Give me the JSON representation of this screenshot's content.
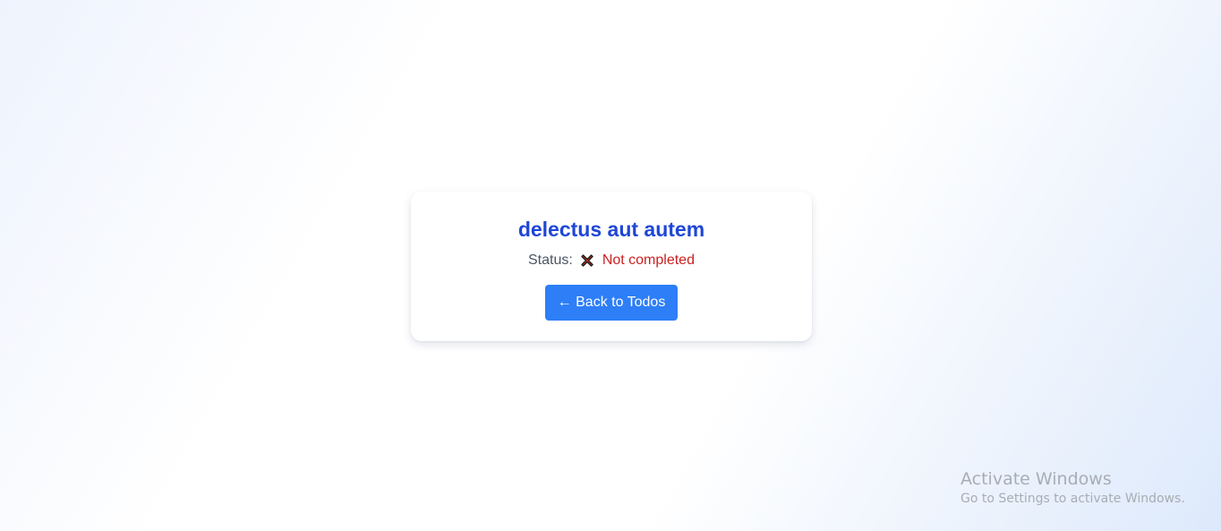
{
  "todo": {
    "title": "delectus aut autem",
    "status_label": "Status:",
    "status_icon": "cross-mark-icon",
    "status_value": "Not completed",
    "status_color": "#cc1f1f"
  },
  "actions": {
    "back_label": "← Back to Todos"
  },
  "watermark": {
    "title": "Activate Windows",
    "subtitle": "Go to Settings to activate Windows."
  },
  "colors": {
    "title": "#1e46d6",
    "button": "#2d7ef7"
  }
}
